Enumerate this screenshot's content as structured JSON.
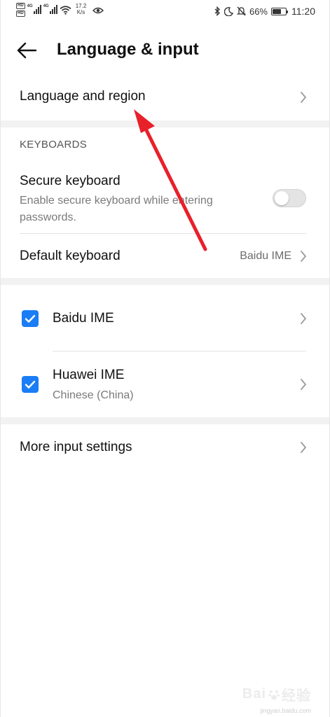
{
  "status_bar": {
    "hd1": "HD",
    "hd2": "HD",
    "net1": "4G",
    "net2": "4G",
    "speed_value": "17.2",
    "speed_unit": "K/s",
    "battery": "66%",
    "battery_level": 0.66,
    "time": "11:20"
  },
  "header": {
    "title": "Language & input"
  },
  "language_region": {
    "label": "Language and region"
  },
  "keyboards": {
    "section_title": "KEYBOARDS",
    "secure": {
      "label": "Secure keyboard",
      "description_line1": "Enable secure keyboard while entering",
      "description_line2": "passwords.",
      "enabled": false
    },
    "default": {
      "label": "Default keyboard",
      "value": "Baidu IME"
    }
  },
  "ime_list": [
    {
      "label": "Baidu IME",
      "sublabel": "",
      "checked": true
    },
    {
      "label": "Huawei IME",
      "sublabel": "Chinese (China)",
      "checked": true
    }
  ],
  "more_settings": {
    "label": "More input settings"
  },
  "colors": {
    "accent": "#1a7df5",
    "annotation_arrow": "#e8202a",
    "divider": "#f2f2f2"
  },
  "watermark": {
    "text": "Bai",
    "tail": "经验",
    "sub": "jingyan.baidu.com"
  }
}
